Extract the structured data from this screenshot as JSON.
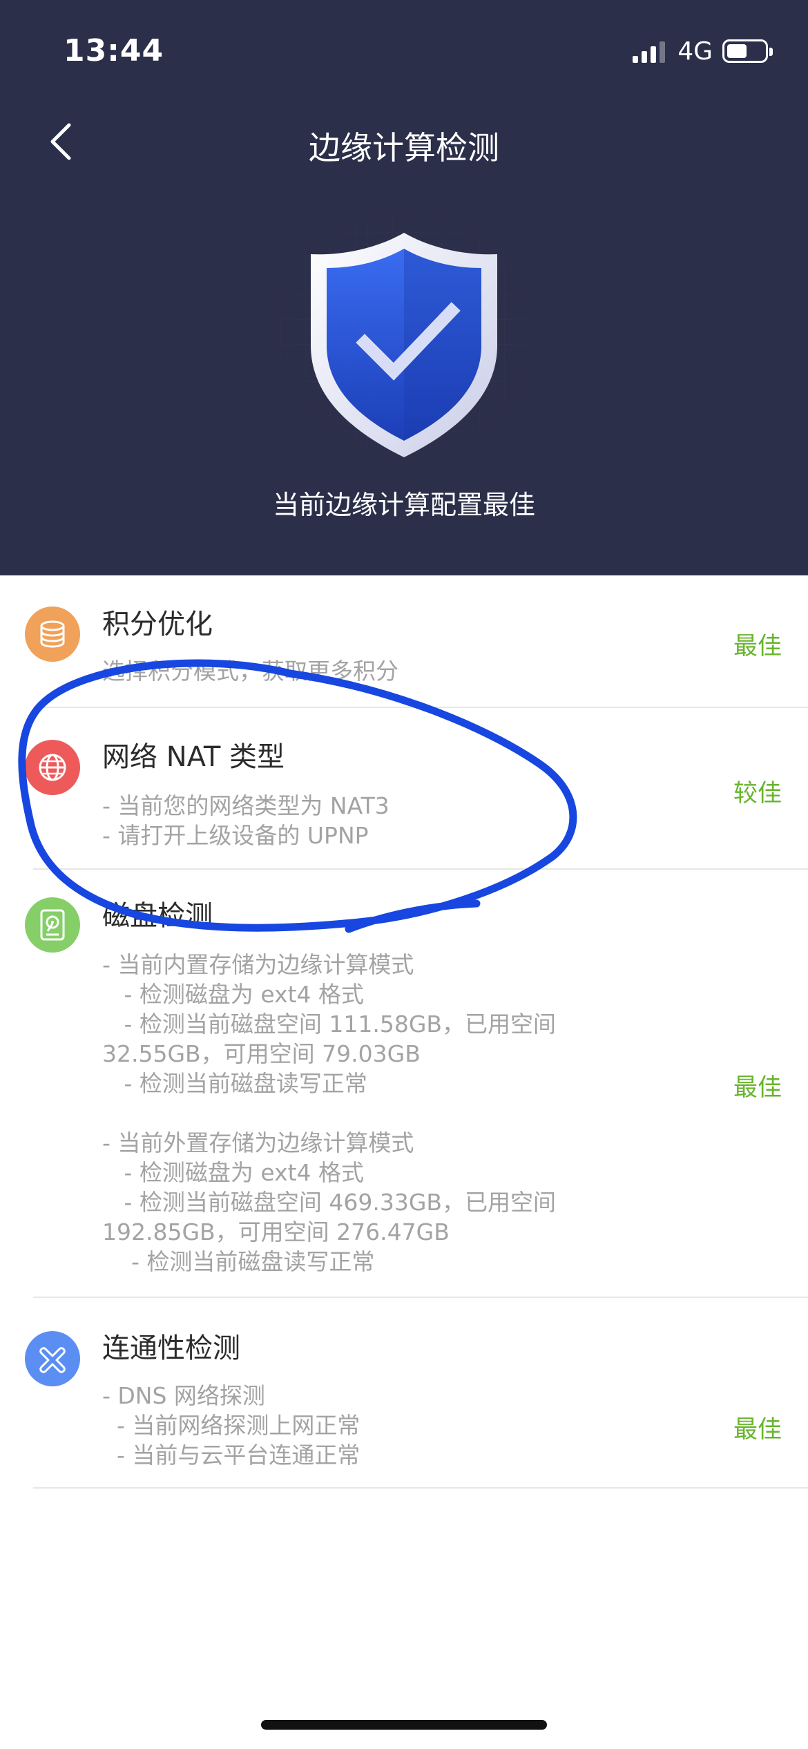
{
  "status_bar": {
    "time": "13:44",
    "network": "4G",
    "battery_level": 0.5
  },
  "header": {
    "title": "边缘计算检测",
    "subtitle": "当前边缘计算配置最佳",
    "colors": {
      "background": "#2c2f4a",
      "shield": "#2b57d8"
    }
  },
  "items": [
    {
      "title": "积分优化",
      "desc": "选择积分模式，获取更多积分",
      "status": "最佳",
      "icon": "database-icon",
      "icon_color": "#f0a15a"
    },
    {
      "title": "网络 NAT 类型",
      "desc": "- 当前您的网络类型为 NAT3\n- 请打开上级设备的 UPNP",
      "status": "较佳",
      "icon": "globe-icon",
      "icon_color": "#ee5a5a"
    },
    {
      "title": "磁盘检测",
      "desc": "- 当前内置存储为边缘计算模式\n   - 检测磁盘为 ext4 格式\n   - 检测当前磁盘空间 111.58GB，已用空间\n32.55GB，可用空间 79.03GB\n   - 检测当前磁盘读写正常\n\n- 当前外置存储为边缘计算模式\n   - 检测磁盘为 ext4 格式\n   - 检测当前磁盘空间 469.33GB，已用空间\n192.85GB，可用空间 276.47GB\n    - 检测当前磁盘读写正常",
      "status": "最佳",
      "icon": "disk-icon",
      "icon_color": "#86cf68"
    },
    {
      "title": "连通性检测",
      "desc": "- DNS 网络探测\n  - 当前网络探测上网正常\n  - 当前与云平台连通正常",
      "status": "最佳",
      "icon": "connectivity-icon",
      "icon_color": "#5b8ef2"
    }
  ],
  "accent_colors": {
    "status_green": "#67b52c",
    "annotation_blue": "#1747e0"
  }
}
